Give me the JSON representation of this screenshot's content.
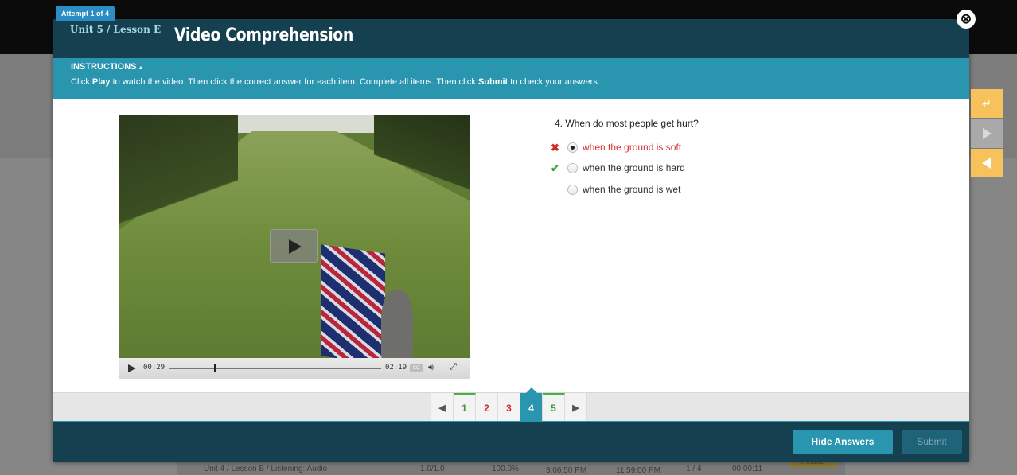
{
  "background": {
    "row": {
      "title": "Unit 4 / Lesson B / Listening: Audio",
      "score": "1.0/1.0",
      "percent": "100.0%",
      "started": "3:06:50 PM",
      "due": "11:59:00 PM",
      "attempts": "1 / 4",
      "time": "00:00:11",
      "action": "Retake"
    }
  },
  "modal": {
    "attempt": "Attempt 1 of 4",
    "unit": "Unit 5 / Lesson E",
    "title": "Video Comprehension",
    "close_icon": "close-circle-icon"
  },
  "instructions": {
    "heading": "INSTRUCTIONS",
    "toggle": "▲",
    "parts": [
      "Click ",
      "Play",
      " to watch the video. Then click the correct answer for each item. Complete all items. Then click ",
      "Submit",
      " to check your answers."
    ]
  },
  "video": {
    "current_time": "00:29",
    "duration": "02:19",
    "cc_label": "CC",
    "progress": 0.21
  },
  "question": {
    "text": "4. When do most people get hurt?",
    "answers": [
      {
        "label": "when the ground is soft",
        "selected": true,
        "status": "wrong",
        "mark": "✖"
      },
      {
        "label": "when the ground is hard",
        "selected": false,
        "status": "correct",
        "mark": "✔"
      },
      {
        "label": "when the ground is wet",
        "selected": false,
        "status": "none",
        "mark": ""
      }
    ]
  },
  "pagination": {
    "prev_icon": "◀",
    "next_icon": "▶",
    "pages": [
      {
        "label": "1",
        "status": "correct"
      },
      {
        "label": "2",
        "status": "wrong"
      },
      {
        "label": "3",
        "status": "wrong"
      },
      {
        "label": "4",
        "status": "current"
      },
      {
        "label": "5",
        "status": "correct"
      }
    ]
  },
  "footer": {
    "hide_answers": "Hide Answers",
    "submit": "Submit"
  },
  "colors": {
    "header": "#14404f",
    "accent": "#2a95ae",
    "wrong": "#d12a2a",
    "correct": "#3aa635",
    "side_tool": "#f7c15c"
  }
}
